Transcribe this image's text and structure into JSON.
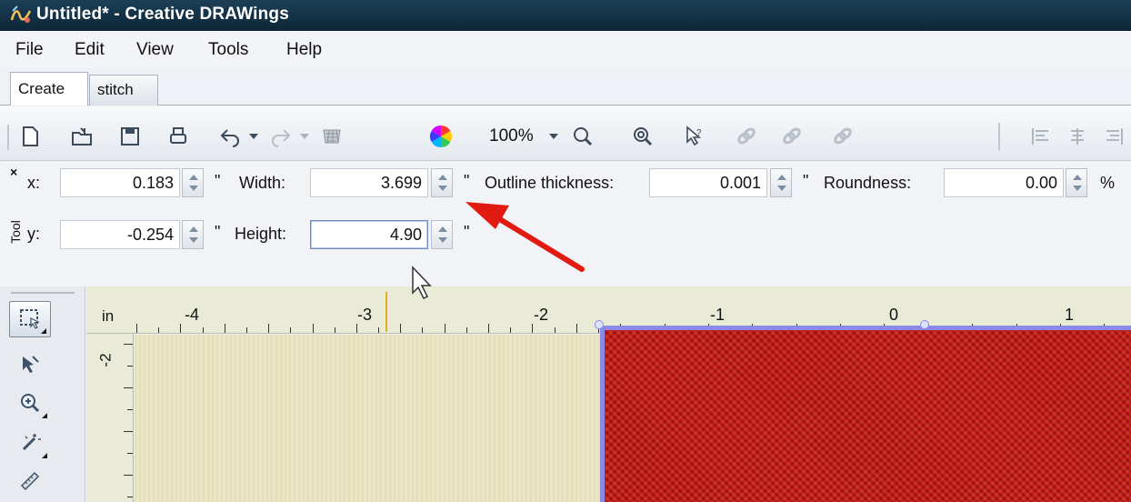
{
  "window": {
    "title": "Untitled* - Creative DRAWings"
  },
  "menu": [
    "File",
    "Edit",
    "View",
    "Tools",
    "Help"
  ],
  "tabs": [
    {
      "label": "Create",
      "active": true
    },
    {
      "label": "stitch",
      "active": false
    }
  ],
  "toolbar": {
    "icons": [
      "new-document-icon",
      "open-folder-icon",
      "save-icon",
      "print-icon",
      "undo-icon",
      "redo-icon",
      "fabric-icon",
      "color-wheel-icon",
      "zoom-in-icon",
      "zoom-fit-icon",
      "help-pointer-icon",
      "link-icon",
      "link-icon",
      "link-icon",
      "align-left-icon",
      "align-center-icon",
      "align-right-icon"
    ],
    "zoom": "100%"
  },
  "properties": {
    "x": {
      "label": "x:",
      "value": "0.183",
      "unit": "\""
    },
    "y": {
      "label": "y:",
      "value": "-0.254",
      "unit": "\""
    },
    "width": {
      "label": "Width:",
      "value": "3.699",
      "unit": "\""
    },
    "height": {
      "label": "Height:",
      "value": "4.90",
      "unit": "\""
    },
    "outline": {
      "label": "Outline thickness:",
      "value": "0.001",
      "unit": "\""
    },
    "roundness": {
      "label": "Roundness:",
      "value": "0.00",
      "unit": "%"
    },
    "panel_label": "Tool",
    "close_glyph": "×"
  },
  "ruler": {
    "unit": "in",
    "top_labels": [
      "-4",
      "-3",
      "-2",
      "-1",
      "0",
      "1"
    ],
    "left_labels": [
      "-2"
    ]
  },
  "colors": {
    "shape_fill": "#b8160f",
    "selection_outline": "#8c8ae8",
    "annotation_arrow": "#e11a12",
    "canvas": "#e6e1be",
    "title_bar": "#0c2638"
  }
}
